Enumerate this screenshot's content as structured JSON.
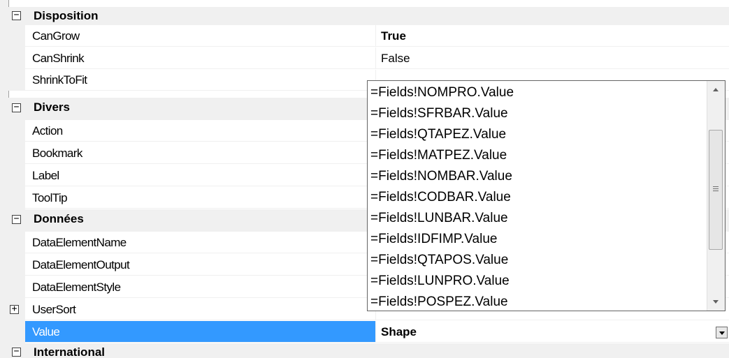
{
  "categories": {
    "disposition": {
      "label": "Disposition",
      "expander": "−"
    },
    "divers": {
      "label": "Divers",
      "expander": "−"
    },
    "donnees": {
      "label": "Données",
      "expander": "−"
    },
    "international": {
      "label": "International",
      "expander": "−"
    }
  },
  "properties": {
    "cangrow": {
      "name": "CanGrow",
      "value": "True"
    },
    "canshrink": {
      "name": "CanShrink",
      "value": "False"
    },
    "shrinktofit": {
      "name": "ShrinkToFit",
      "value": ""
    },
    "action": {
      "name": "Action",
      "value": ""
    },
    "bookmark": {
      "name": "Bookmark",
      "value": ""
    },
    "label": {
      "name": "Label",
      "value": ""
    },
    "tooltip": {
      "name": "ToolTip",
      "value": ""
    },
    "dataelementname": {
      "name": "DataElementName",
      "value": ""
    },
    "dataelementoutput": {
      "name": "DataElementOutput",
      "value": ""
    },
    "dataelementstyle": {
      "name": "DataElementStyle",
      "value": ""
    },
    "usersort": {
      "name": "UserSort",
      "value": "",
      "expander": "+"
    },
    "value": {
      "name": "Value",
      "value": "Shape"
    }
  },
  "dropdown": {
    "items": [
      "=Fields!NOMPRO.Value",
      "=Fields!SFRBAR.Value",
      "=Fields!QTAPEZ.Value",
      "=Fields!MATPEZ.Value",
      "=Fields!NOMBAR.Value",
      "=Fields!CODBAR.Value",
      "=Fields!LUNBAR.Value",
      "=Fields!IDFIMP.Value",
      "=Fields!QTAPOS.Value",
      "=Fields!LUNPRO.Value",
      "=Fields!POSPEZ.Value"
    ]
  },
  "colors": {
    "selection": "#3399ff",
    "category_bg": "#f0f0f0"
  }
}
